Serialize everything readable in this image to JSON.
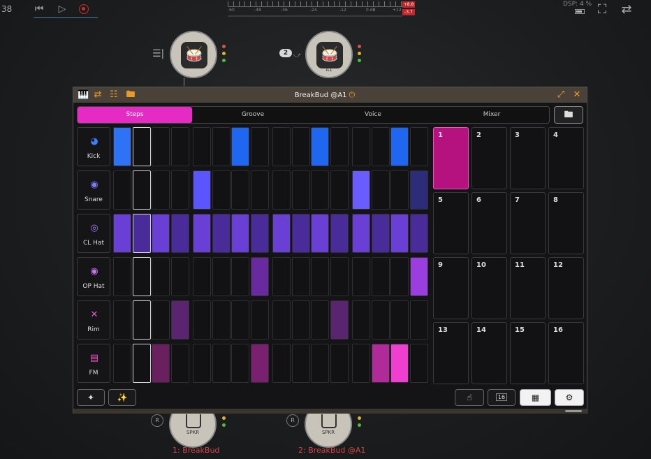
{
  "transport": {
    "bpm": "38",
    "meter_labels": [
      "-60",
      "-48",
      "-36",
      "-24",
      "-12",
      "0 dB",
      "+12"
    ],
    "peak_top": "+8.8",
    "peak_bottom": "-3.7",
    "dsp": "DSP: 4 %"
  },
  "graph": {
    "node2_label": "A1",
    "channel_badge": "2",
    "out1_label": "1: BreakBud",
    "out2_label": "2: BreakBud @A1",
    "spkr": "SPKR",
    "r_button": "R"
  },
  "window": {
    "title": "BreakBud @A1"
  },
  "tabs": [
    {
      "label": "Steps",
      "active": true
    },
    {
      "label": "Groove",
      "active": false
    },
    {
      "label": "Voice",
      "active": false
    },
    {
      "label": "Mixer",
      "active": false
    }
  ],
  "instruments": [
    {
      "name": "Kick",
      "icon": "kick-drum-icon",
      "color": "#3f7dff"
    },
    {
      "name": "Snare",
      "icon": "snare-drum-icon",
      "color": "#7b7dff"
    },
    {
      "name": "CL Hat",
      "icon": "closed-hihat-icon",
      "color": "#a779ff"
    },
    {
      "name": "OP Hat",
      "icon": "open-hihat-icon",
      "color": "#c96fe8"
    },
    {
      "name": "Rim",
      "icon": "rimshot-icon",
      "color": "#e05cc0"
    },
    {
      "name": "FM",
      "icon": "fm-synth-icon",
      "color": "#f04fc8"
    }
  ],
  "current_step": 2,
  "steps": {
    "Kick": [
      1,
      0,
      0,
      0,
      0,
      0,
      1,
      0,
      0,
      0,
      1,
      0,
      0,
      0,
      1,
      0
    ],
    "Snare": [
      0,
      0,
      0,
      0,
      1,
      0,
      0,
      0,
      0,
      0,
      0,
      0,
      1,
      0,
      0,
      1
    ],
    "CL Hat": [
      1,
      1,
      1,
      1,
      1,
      1,
      1,
      1,
      1,
      1,
      1,
      1,
      1,
      1,
      1,
      1
    ],
    "OP Hat": [
      0,
      0,
      0,
      0,
      0,
      0,
      0,
      1,
      0,
      0,
      0,
      0,
      0,
      0,
      0,
      1
    ],
    "Rim": [
      0,
      0,
      0,
      1,
      0,
      0,
      0,
      0,
      0,
      0,
      0,
      1,
      0,
      0,
      0,
      0
    ],
    "FM": [
      0,
      0,
      1,
      0,
      0,
      0,
      0,
      1,
      0,
      0,
      0,
      0,
      0,
      1,
      1,
      0
    ]
  },
  "step_colors": {
    "Kick": [
      "#2e73f5",
      "",
      "",
      "",
      "",
      "",
      "#1f66f0",
      "",
      "",
      "",
      "#1f66f0",
      "",
      "",
      "",
      "#1f66f0",
      ""
    ],
    "Snare": [
      "",
      "",
      "",
      "",
      "#5b55ff",
      "",
      "",
      "",
      "",
      "",
      "",
      "",
      "#6a5dff",
      "",
      "",
      "#2d2c7a"
    ],
    "CL Hat": [
      "#6a3fd6",
      "#4a2b9a",
      "#6a3fd6",
      "#4a2b9a",
      "#6a3fd6",
      "#4a2b9a",
      "#6a3fd6",
      "#4a2b9a",
      "#6a3fd6",
      "#4a2b9a",
      "#6a3fd6",
      "#4a2b9a",
      "#6a3fd6",
      "#4a2b9a",
      "#6a3fd6",
      "#4a2b9a"
    ],
    "OP Hat": [
      "",
      "",
      "",
      "",
      "",
      "",
      "",
      "#6a2a9f",
      "",
      "",
      "",
      "",
      "",
      "",
      "",
      "#9a3ee0"
    ],
    "Rim": [
      "",
      "",
      "",
      "#5a2470",
      "",
      "",
      "",
      "",
      "",
      "",
      "",
      "#5a2470",
      "",
      "",
      "",
      ""
    ],
    "FM": [
      "",
      "",
      "#6a1f5e",
      "",
      "",
      "",
      "",
      "#7a2070",
      "",
      "",
      "",
      "",
      "",
      "#b02a9a",
      "#f03fd0",
      ""
    ]
  },
  "patterns": [
    "1",
    "2",
    "3",
    "4",
    "5",
    "6",
    "7",
    "8",
    "9",
    "10",
    "11",
    "12",
    "13",
    "14",
    "15",
    "16"
  ],
  "selected_pattern": "1",
  "bottom": {
    "length_value": "16"
  }
}
